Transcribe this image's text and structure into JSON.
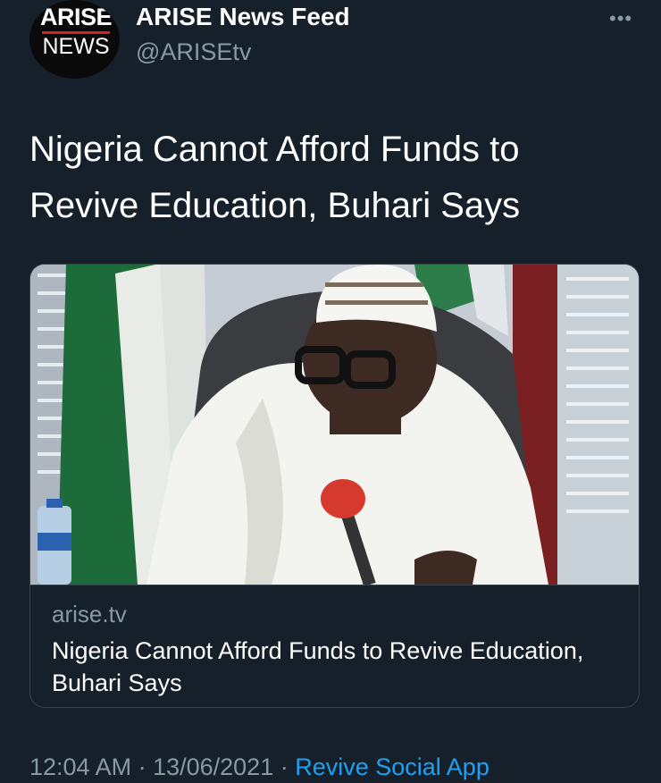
{
  "account": {
    "avatar_line1": "ARISE",
    "avatar_line2": "NEWS",
    "display_name": "ARISE News Feed",
    "handle": "@ARISEtv"
  },
  "more_icon": "more-horizontal-icon",
  "tweet": {
    "text": "Nigeria Cannot Afford Funds to Revive Education, Buhari Says"
  },
  "card": {
    "domain": "arise.tv",
    "title": "Nigeria Cannot Afford Funds to Revive Education, Buhari Says"
  },
  "meta": {
    "time": "12:04 AM",
    "separator1": " · ",
    "date": "13/06/2021",
    "separator2": " · ",
    "source": "Revive Social App"
  },
  "colors": {
    "background": "#15202b",
    "secondary_text": "#8899a6",
    "link": "#1da1f2",
    "border": "#38444d"
  }
}
